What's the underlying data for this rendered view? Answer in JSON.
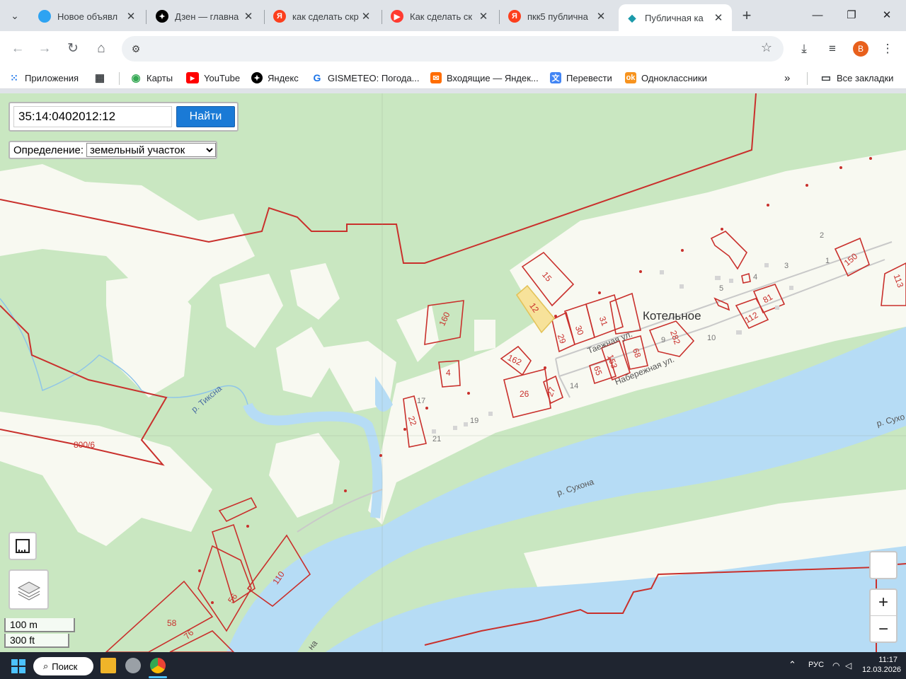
{
  "browser": {
    "tabs": [
      {
        "title": "Новое объявл",
        "color": "#2ea3f2",
        "glyph": "●"
      },
      {
        "title": "Дзен — главна",
        "color": "#000000",
        "glyph": "✦"
      },
      {
        "title": "как сделать скр",
        "color": "#fc3f1d",
        "glyph": "Я"
      },
      {
        "title": "Как сделать ск",
        "color": "#ff3b30",
        "glyph": "▶"
      },
      {
        "title": "пкк5 публична",
        "color": "#fc3f1d",
        "glyph": "Я"
      },
      {
        "title": "Публичная ка",
        "color": "#1b9aaa",
        "glyph": "◆",
        "active": true
      }
    ],
    "new_tab": "+",
    "profile_initial": "В",
    "url": ""
  },
  "bookmarks": [
    {
      "label": "Приложения",
      "icon": "apps-grid-icon"
    },
    {
      "label": "Карты",
      "icon": "maps-pin-icon"
    },
    {
      "label": "YouTube",
      "icon": "youtube-icon"
    },
    {
      "label": "Яндекс",
      "icon": "yandex-star-icon"
    },
    {
      "label": "GISMETEO: Погода...",
      "icon": "gismeteo-icon"
    },
    {
      "label": "Входящие — Яндек...",
      "icon": "mail-icon"
    },
    {
      "label": "Перевести",
      "icon": "translate-icon"
    },
    {
      "label": "Одноклассники",
      "icon": "ok-icon"
    },
    {
      "label": "Все закладки",
      "icon": "folder-icon"
    }
  ],
  "search": {
    "query": "35:14:0402012:12",
    "button": "Найти",
    "definition_label": "Определение:",
    "definition_value": "земельный участок"
  },
  "map_labels": {
    "village": "Котельное",
    "river_sukhona": "р. Сухона",
    "river_sukhona_edge": "р. Сухо",
    "river_tiksna": "р. Тиксна",
    "river_tiksna_bottom": "на",
    "street_tayozhnaya": "Таежная ул.",
    "street_naberezhnaya": "Набережная ул.",
    "zone": "800/6"
  },
  "parcels": [
    "15",
    "12",
    "160",
    "4",
    "162",
    "26",
    "27",
    "22",
    "29",
    "30",
    "31",
    "65",
    "153",
    "68",
    "282",
    "112",
    "81",
    "150",
    "113",
    "110",
    "56",
    "58",
    "76"
  ],
  "house_numbers": [
    "2",
    "1",
    "3",
    "4",
    "5",
    "10",
    "14",
    "17",
    "19",
    "21",
    "9"
  ],
  "scale": {
    "metric": "100 m",
    "imperial": "300 ft"
  },
  "zoom": {
    "in": "+",
    "out": "−"
  },
  "taskbar": {
    "search": "Поиск",
    "lang": "РУС",
    "time": "11:17",
    "date": "12.03.2026"
  }
}
